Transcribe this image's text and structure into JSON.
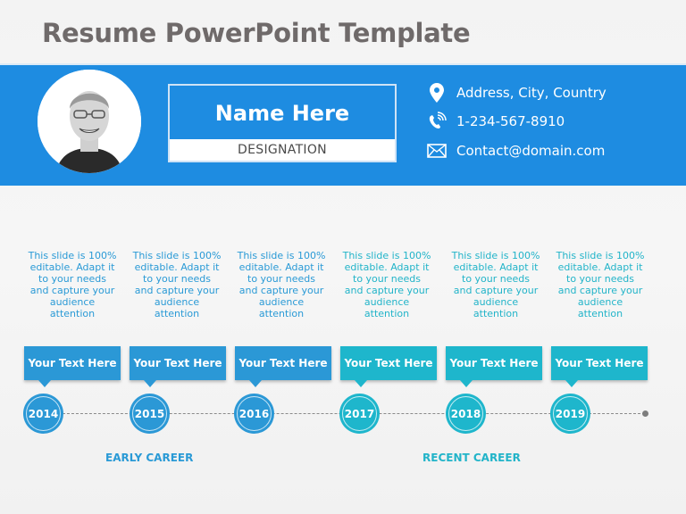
{
  "title": "Resume PowerPoint Template",
  "profile": {
    "name": "Name Here",
    "designation": "DESIGNATION",
    "photo_icon": "person-portrait"
  },
  "contact": {
    "address": {
      "icon": "location-pin-icon",
      "text": "Address, City, Country"
    },
    "phone": {
      "icon": "phone-icon",
      "text": "1-234-567-8910"
    },
    "email": {
      "icon": "envelope-icon",
      "text": "Contact@domain.com"
    }
  },
  "colors": {
    "banner": "#1e8ce1",
    "early": "#2b98d6",
    "recent": "#1eb6cc",
    "title": "#6f6a6a"
  },
  "timeline": [
    {
      "year": "2014",
      "label": "Your Text Here",
      "description": "This slide is 100% editable. Adapt it to your needs and capture your audience attention",
      "phase": "early"
    },
    {
      "year": "2015",
      "label": "Your Text Here",
      "description": "This slide is 100% editable. Adapt it to your needs and capture your audience attention",
      "phase": "early"
    },
    {
      "year": "2016",
      "label": "Your Text Here",
      "description": "This slide is 100% editable. Adapt it to your needs and capture your audience attention",
      "phase": "early"
    },
    {
      "year": "2017",
      "label": "Your Text Here",
      "description": "This slide is 100% editable. Adapt it to your needs and capture your audience attention",
      "phase": "recent"
    },
    {
      "year": "2018",
      "label": "Your Text Here",
      "description": "This slide is 100% editable. Adapt it to your needs and capture your audience attention",
      "phase": "recent"
    },
    {
      "year": "2019",
      "label": "Your Text Here",
      "description": "This slide is 100% editable. Adapt it to your needs and capture your audience attention",
      "phase": "recent"
    }
  ],
  "phases": {
    "early": "EARLY CAREER",
    "recent": "RECENT CAREER"
  }
}
